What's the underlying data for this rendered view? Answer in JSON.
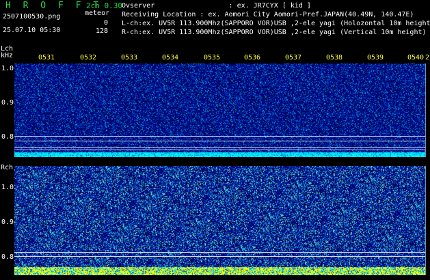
{
  "header": {
    "app_title": "H R O F F T",
    "version": "2ch 0.30",
    "filename": "2507100530.png",
    "datetime": "25.07.10 05:30",
    "meteor_label": "meteor",
    "l_count": "0",
    "r_count": "128"
  },
  "info": {
    "observer": "Ovserver                  : ex. JR7CYX [ kid ]",
    "location": "Receiving Location : ex. Aomori City Aomori-Pref.JAPAN(40.49N, 140.47E)",
    "lch": "L-ch:ex. UV5R 113.900Mhz(SAPPORO VOR)USB ,2-ele yagi (Holozontal 10m height)",
    "rch": "R-ch:ex. UV5R 113.900Mhz(SAPPORO VOR)USB ,2-ele yagi (Vertical 10m height)"
  },
  "lch_panel": {
    "label": "Lch",
    "unit": "kHz",
    "yticks": [
      "1.0",
      "0.9",
      "0.8"
    ]
  },
  "rch_panel": {
    "label": "Rch",
    "yticks": [
      "1.0",
      "0.9",
      "0.8"
    ]
  },
  "time_marks": [
    "0531",
    "0532",
    "0533",
    "0534",
    "0535",
    "0536",
    "0537",
    "0538",
    "0539",
    "0540",
    "2"
  ],
  "colors": {
    "background": "#000000",
    "title_green": "#2bd94a",
    "time_mark_yellow": "#ffff40",
    "noise_cyan": "#00e8ff",
    "noise_yellow": "#ffff00"
  }
}
